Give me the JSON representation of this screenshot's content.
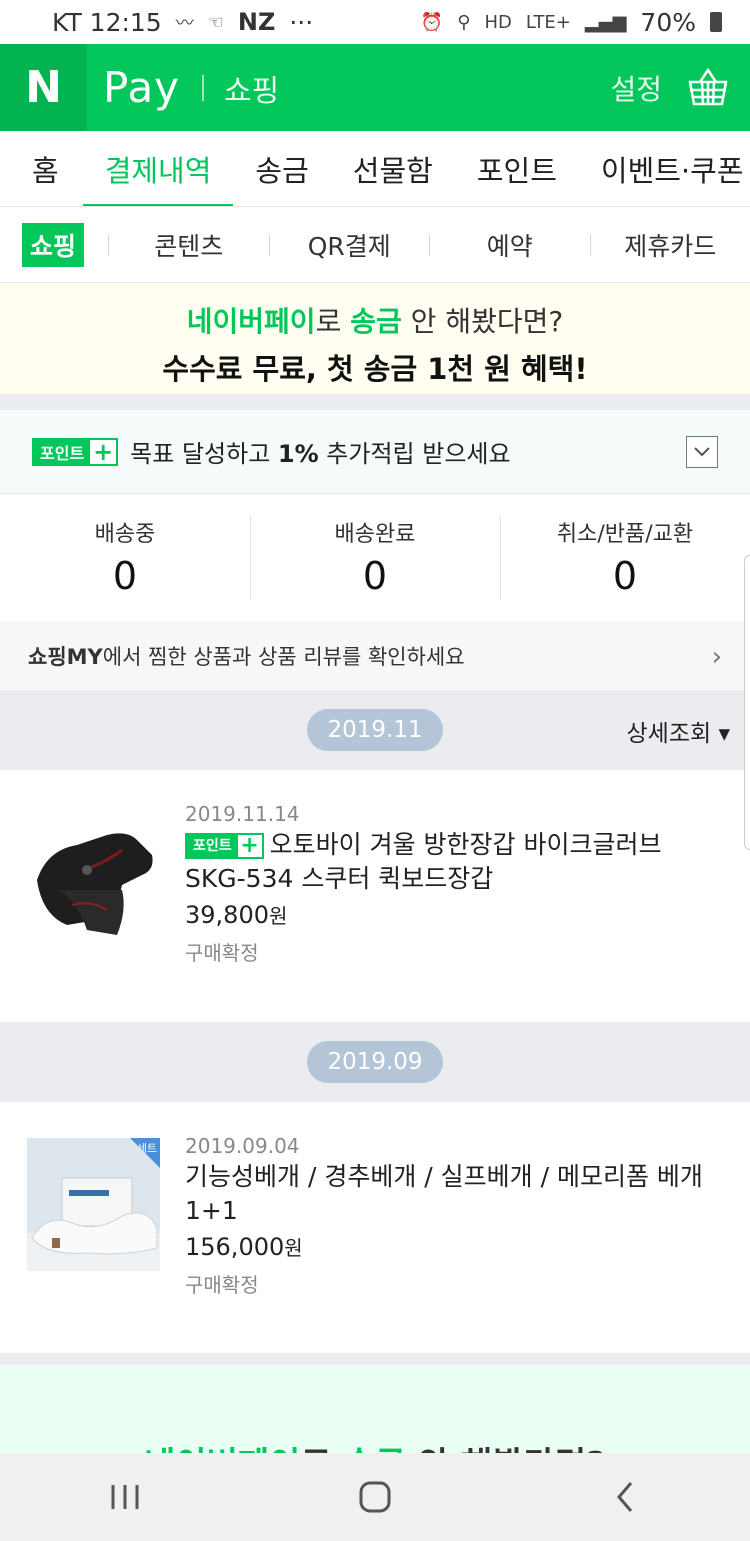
{
  "status_bar": {
    "carrier_time": "KT 12:15",
    "nz": "NZ",
    "dots": "···",
    "lte": "LTE+",
    "battery": "70%"
  },
  "header": {
    "logo": "N",
    "title": "Pay",
    "subtitle": "쇼핑",
    "settings": "설정"
  },
  "main_tabs": [
    {
      "label": "홈"
    },
    {
      "label": "결제내역"
    },
    {
      "label": "송금"
    },
    {
      "label": "선물함"
    },
    {
      "label": "포인트"
    },
    {
      "label": "이벤트·쿠폰"
    }
  ],
  "sub_tabs": [
    {
      "label": "쇼핑"
    },
    {
      "label": "콘텐츠"
    },
    {
      "label": "QR결제"
    },
    {
      "label": "예약"
    },
    {
      "label": "제휴카드"
    }
  ],
  "banner": {
    "line1_a": "네이버페이",
    "line1_b": "로 ",
    "line1_c": "송금",
    "line1_d": " 안 해봤다면?",
    "line2": "수수료 무료, 첫 송금 1천 원 혜택!"
  },
  "point_plus": {
    "badge": "포인트",
    "plus": "+",
    "text_a": "목표 달성하고 ",
    "text_b": "1%",
    "text_c": " 추가적립 받으세요"
  },
  "stats": [
    {
      "label": "배송중",
      "value": "0"
    },
    {
      "label": "배송완료",
      "value": "0"
    },
    {
      "label": "취소/반품/교환",
      "value": "0"
    }
  ],
  "my_link": {
    "bold": "쇼핑MY",
    "text": "에서 찜한 상품과 상품 리뷰를 확인하세요"
  },
  "months": [
    {
      "label": "2019.11",
      "detail": "상세조회 ▾",
      "order": {
        "date": "2019.11.14",
        "name": "오토바이 겨울 방한장갑 바이크글러브 SKG-534 스쿠터 퀵보드장갑",
        "price": "39,800",
        "won": "원",
        "status": "구매확정",
        "point_plus": true
      }
    },
    {
      "label": "2019.09",
      "order": {
        "date": "2019.09.04",
        "name": "기능성베개 / 경추베개 / 실프베개 / 메모리폼 베개 1+1",
        "price": "156,000",
        "won": "원",
        "status": "구매확정",
        "set_badge": "세트"
      }
    }
  ],
  "promo": {
    "a": "네이버페이",
    "b": "로 ",
    "c": "송금",
    "d": " 안 해봤다면?"
  },
  "colors": {
    "brand_green": "#03c75a",
    "month_pill": "#b3c5d7"
  },
  "icons": {
    "cart": "shopping-basket-icon",
    "nav_recent": "recent-apps-icon",
    "nav_home": "home-icon",
    "nav_back": "back-icon"
  }
}
